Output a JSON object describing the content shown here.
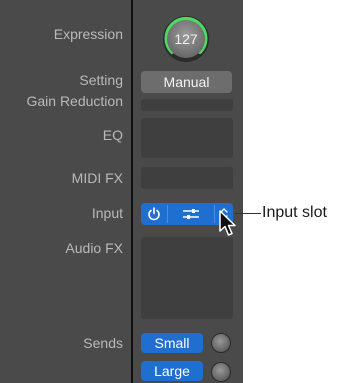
{
  "strip": {
    "expression": {
      "label": "Expression",
      "value": "127"
    },
    "setting": {
      "label": "Setting",
      "value": "Manual"
    },
    "gain_reduction": {
      "label": "Gain Reduction"
    },
    "eq": {
      "label": "EQ"
    },
    "midi_fx": {
      "label": "MIDI FX"
    },
    "input": {
      "label": "Input"
    },
    "audio_fx": {
      "label": "Audio FX"
    },
    "sends": {
      "label": "Sends",
      "items": [
        "Small",
        "Large"
      ]
    }
  },
  "callout": {
    "text": "Input slot"
  },
  "colors": {
    "accent": "#1f6fd1",
    "knob_ring": "#4cd964",
    "panel": "#4a4a4a"
  }
}
